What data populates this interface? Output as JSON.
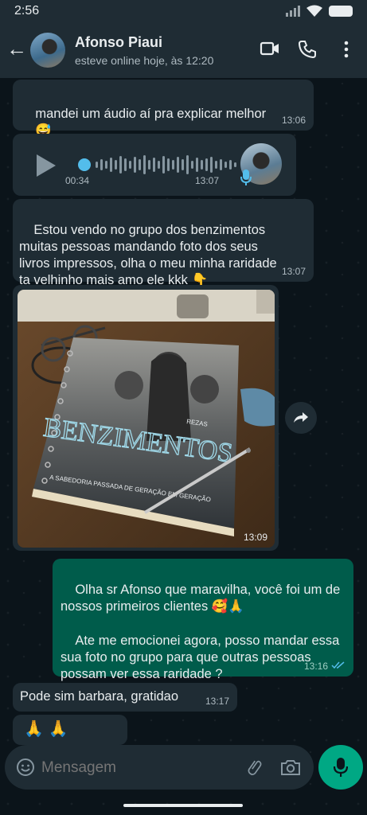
{
  "status_bar": {
    "time": "2:56"
  },
  "header": {
    "contact_name": "Afonso Piaui",
    "contact_status": "esteve online hoje, às 12:20"
  },
  "messages": [
    {
      "direction": "in",
      "text": "mandei um áudio aí pra explicar melhor",
      "emoji": "😅",
      "time": "13:06"
    },
    {
      "direction": "in",
      "type": "audio",
      "duration": "00:34",
      "time": "13:07"
    },
    {
      "direction": "in",
      "text": "Estou vendo no grupo dos benzimentos\nmuitas pessoas mandando foto dos seus\nlivros impressos, olha o meu minha raridade\nta velhinho mais amo ele kkk",
      "emoji": "👇",
      "time": "13:07"
    },
    {
      "direction": "in",
      "type": "image",
      "book_title": "BENZIMENTOS",
      "book_subtitle": "REZAS",
      "book_tagline": "A SABEDORIA PASSADA DE GERAÇÃO EM GERAÇÃO",
      "time": "13:09"
    },
    {
      "direction": "out",
      "text": "Olha sr Afonso que maravilha, você foi um de\nnossos primeiros clientes",
      "emoji": "🥰🙏",
      "text2": "Ate me emocionei agora, posso mandar essa\nsua foto no grupo para que outras pessoas\npossam ver essa raridade ?",
      "time": "13:16",
      "read": true
    },
    {
      "direction": "in",
      "text": "Pode sim barbara, gratidao",
      "time": "13:17"
    },
    {
      "direction": "in",
      "text": "🙏 🙏"
    }
  ],
  "input": {
    "placeholder": "Mensagem"
  },
  "colors": {
    "incoming": "#1f2c34",
    "outgoing": "#005c4b",
    "accent": "#00a884",
    "read_ticks": "#53bdeb"
  }
}
